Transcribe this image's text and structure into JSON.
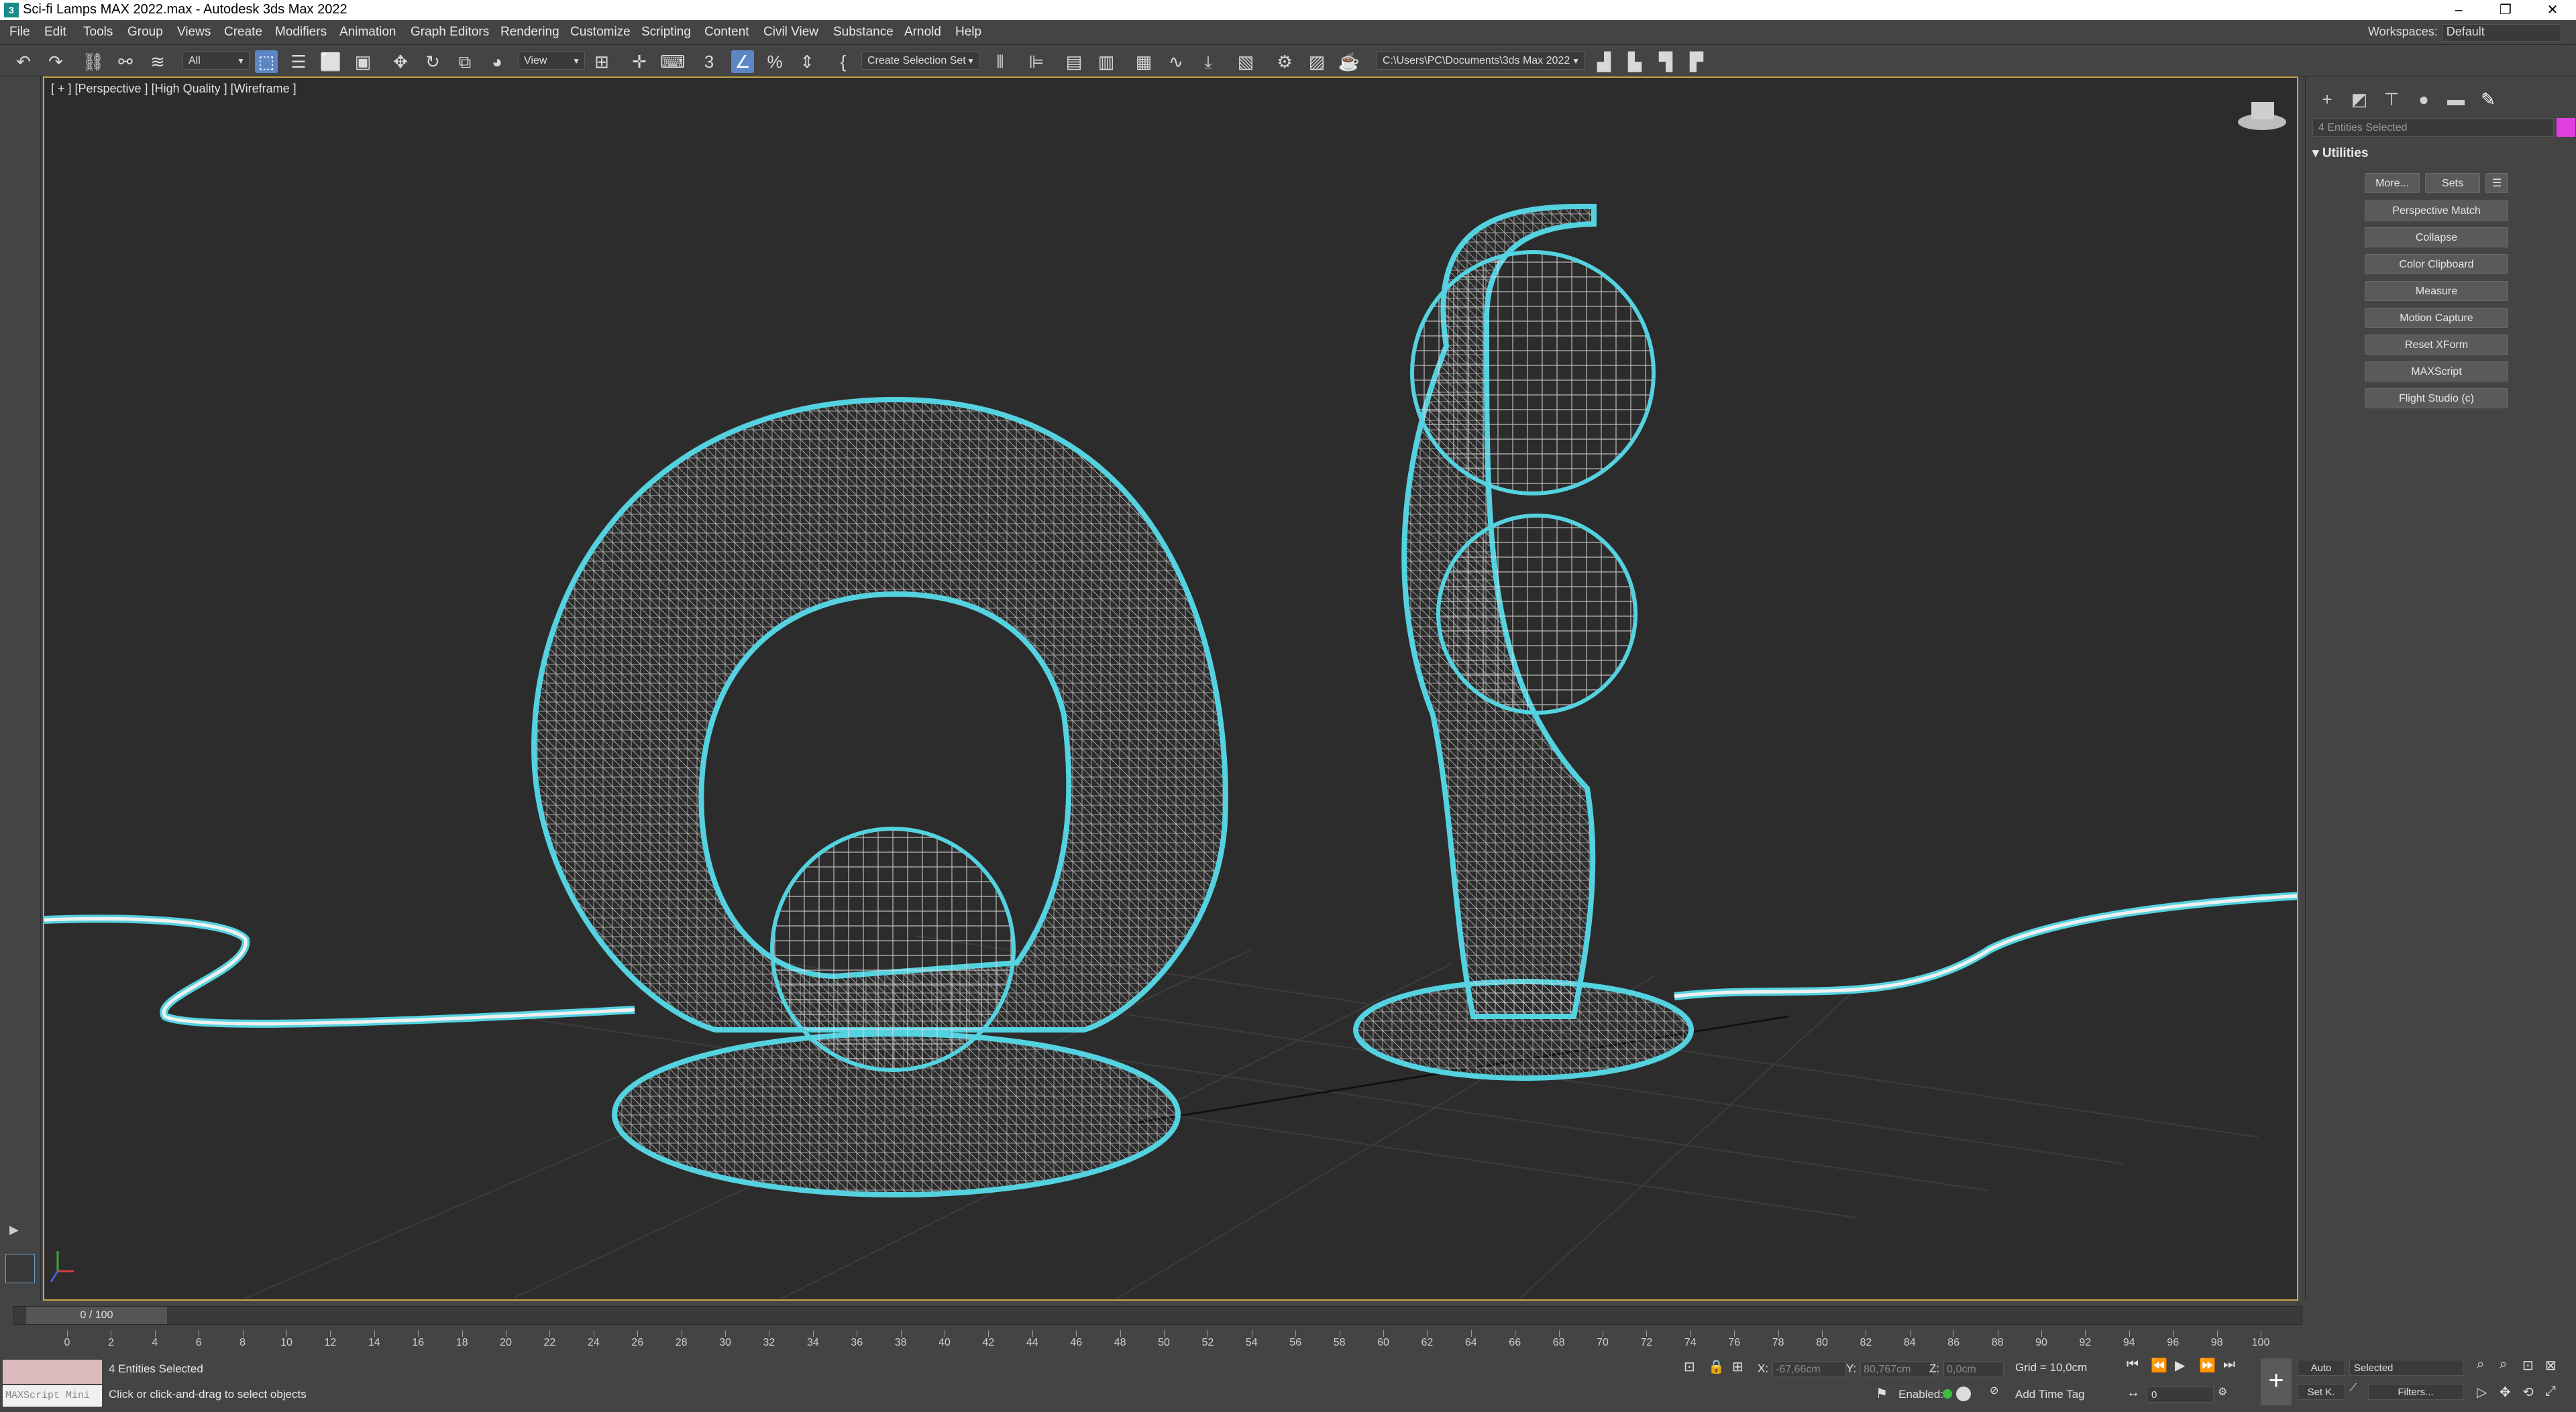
{
  "window": {
    "title": "Sci-fi Lamps MAX 2022.max - Autodesk 3ds Max 2022",
    "minimize": "–",
    "restore": "❐",
    "close": "✕"
  },
  "menu": {
    "items": [
      "File",
      "Edit",
      "Tools",
      "Group",
      "Views",
      "Create",
      "Modifiers",
      "Animation",
      "Graph Editors",
      "Rendering",
      "Customize",
      "Scripting",
      "Content",
      "Civil View",
      "Substance",
      "Arnold",
      "Help"
    ],
    "workspaces_label": "Workspaces:",
    "workspaces_value": "Default"
  },
  "toolbar": {
    "selection_filter": "All",
    "ref_coord": "View",
    "named_selection": "Create Selection Set",
    "project_path": "C:\\Users\\PC\\Documents\\3ds Max 2022",
    "icons": [
      "undo-icon",
      "redo-icon",
      "link-icon",
      "unlink-icon",
      "bind-space-warp-icon",
      "select-object-icon",
      "select-by-name-icon",
      "rect-selection-icon",
      "window-crossing-icon",
      "move-icon",
      "rotate-icon",
      "scale-icon",
      "place-icon",
      "pivot-icon",
      "select-manipulate-icon",
      "keyboard-shortcut-icon",
      "snaps-3d-icon",
      "angle-snap-icon",
      "percent-snap-icon",
      "spinner-snap-icon",
      "edit-named-sets-icon",
      "mirror-icon",
      "align-icon",
      "scene-explorer-icon",
      "layer-explorer-icon",
      "toggle-ribbon-icon",
      "curve-editor-icon",
      "schematic-view-icon",
      "material-editor-icon",
      "render-setup-icon",
      "rendered-frame-icon",
      "render-icon"
    ]
  },
  "viewport": {
    "label": "[ + ] [Perspective ] [High Quality ] [Wireframe ]",
    "wire_color": "#ffffff",
    "selection_color": "#54d2e0",
    "background": "#2c2c2c"
  },
  "command_panel": {
    "tabs": [
      "create-icon",
      "modify-icon",
      "hierarchy-icon",
      "motion-icon",
      "display-icon",
      "utilities-icon"
    ],
    "selection_field": "4 Entities Selected",
    "rollout_title": "Utilities",
    "buttons": {
      "more": "More...",
      "sets": "Sets",
      "perspective_match": "Perspective Match",
      "collapse": "Collapse",
      "color_clipboard": "Color Clipboard",
      "measure": "Measure",
      "motion_capture": "Motion Capture",
      "reset_xform": "Reset XForm",
      "maxscript": "MAXScript",
      "flight_studio": "Flight Studio (c)"
    }
  },
  "timeline": {
    "slider_label": "0 / 100",
    "ticks": [
      "0",
      "2",
      "4",
      "6",
      "8",
      "10",
      "12",
      "14",
      "16",
      "18",
      "20",
      "22",
      "24",
      "26",
      "28",
      "30",
      "32",
      "34",
      "36",
      "38",
      "40",
      "42",
      "44",
      "46",
      "48",
      "50",
      "52",
      "54",
      "56",
      "58",
      "60",
      "62",
      "64",
      "66",
      "68",
      "70",
      "72",
      "74",
      "76",
      "78",
      "80",
      "82",
      "84",
      "86",
      "88",
      "90",
      "92",
      "94",
      "96",
      "98",
      "100"
    ]
  },
  "status": {
    "maxscript_placeholder": "MAXScript Mini",
    "line1": "4 Entities Selected",
    "line2": "Click or click-and-drag to select objects",
    "x_label": "X:",
    "x_value": "-67,66cm",
    "y_label": "Y:",
    "y_value": "80,767cm",
    "z_label": "Z:",
    "z_value": "0,0cm",
    "grid": "Grid = 10,0cm",
    "enabled": "Enabled:",
    "add_time_tag": "Add Time Tag",
    "auto": "Auto",
    "set_key": "Set K.",
    "key_mode": "Selected",
    "filters": "Filters...",
    "frame_value": "0"
  }
}
